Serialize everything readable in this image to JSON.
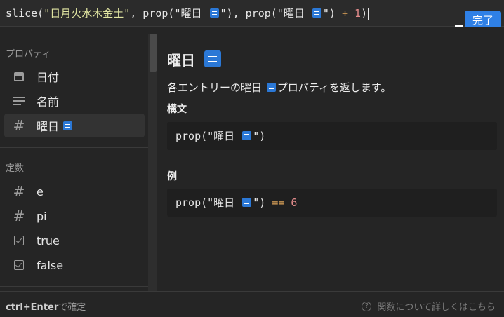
{
  "editor": {
    "formula": {
      "t1": "slice(",
      "t2": "\"日月火水木金土\"",
      "t3": ", prop(\"",
      "t4": "曜日 ",
      "t5": "\"), prop(\"",
      "t6": "曜日 ",
      "t7": "\") ",
      "t8": "+",
      "t9": " 1",
      "t10": ")"
    },
    "done_label": "完了"
  },
  "sidebar": {
    "properties_label": "プロパティ",
    "properties": [
      {
        "label": "日付",
        "icon": "calendar-icon"
      },
      {
        "label": "名前",
        "icon": "text-lines-icon"
      },
      {
        "label": "曜日",
        "icon": "hash-icon"
      }
    ],
    "constants_label": "定数",
    "constants": [
      {
        "label": "e",
        "icon": "hash-icon"
      },
      {
        "label": "pi",
        "icon": "hash-icon"
      },
      {
        "label": "true",
        "icon": "checkbox-icon"
      },
      {
        "label": "false",
        "icon": "checkbox-icon"
      }
    ]
  },
  "docs": {
    "title": "曜日",
    "description_pre": "各エントリーの曜日 ",
    "description_post": "プロパティを返します。",
    "syntax_heading": "構文",
    "syntax_code": "prop(\"曜日 ",
    "syntax_code_end": "\")",
    "example_heading": "例",
    "example_code": "prop(\"曜日 ",
    "example_code_mid": "\") ",
    "example_op": "==",
    "example_num": " 6"
  },
  "footer": {
    "shortcut_key": "ctrl+Enter",
    "shortcut_text": "で確定",
    "learn_more": "関数について詳しくはこちら"
  }
}
